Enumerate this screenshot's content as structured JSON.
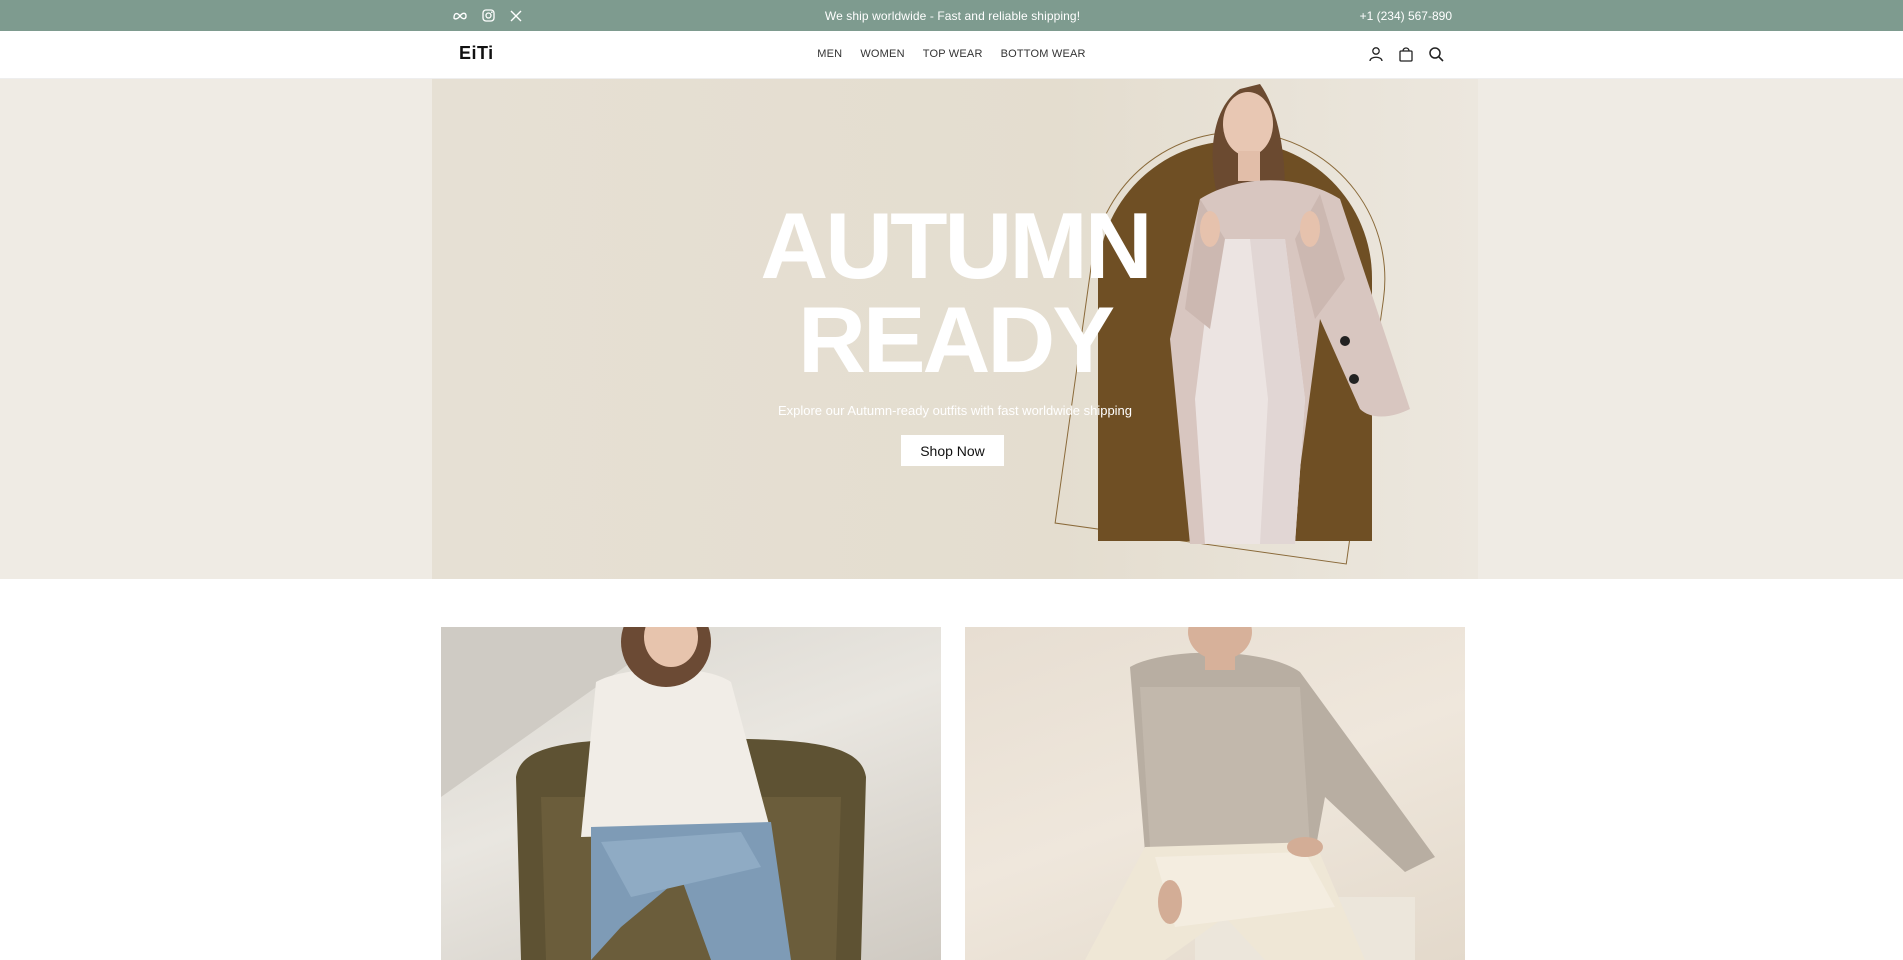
{
  "topbar": {
    "message": "We ship worldwide - Fast and reliable shipping!",
    "phone": "+1 (234) 567-890",
    "socials": [
      "meta-icon",
      "instagram-icon",
      "x-icon"
    ]
  },
  "header": {
    "logo": "EiTi",
    "nav": [
      "MEN",
      "WOMEN",
      "TOP WEAR",
      "BOTTOM WEAR"
    ],
    "icons": [
      "user-icon",
      "shopping-bag-icon",
      "search-icon"
    ]
  },
  "hero": {
    "headline_line1": "AUTUMN",
    "headline_line2": "READY",
    "subtitle": "Explore our Autumn-ready outfits with fast worldwide shipping",
    "cta": "Shop Now"
  },
  "colors": {
    "topbar": "#7e9b8f",
    "hero_bg": "#e4ddcf",
    "arch": "#6f4f24",
    "page_bg": "#efebe4"
  }
}
